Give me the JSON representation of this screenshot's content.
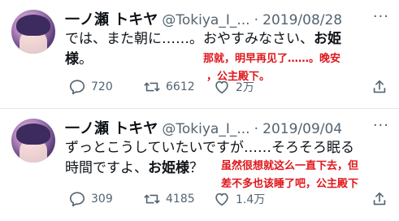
{
  "tweets": [
    {
      "name": "一ノ瀬 トキヤ",
      "handle": "@Tokiya_I_...",
      "separator": "·",
      "date": "2019/08/28",
      "more": "···",
      "text_line1_plain": "では、また朝に……。おやすみなさい、",
      "text_line1_bold": "お姫",
      "text_line2_bold": "様",
      "text_line2_plain": "。",
      "annotation_lines": [
        "那就，明早再见了……。晚安",
        "，公主殿下。"
      ],
      "replies": "720",
      "retweets": "6612",
      "likes": "2万"
    },
    {
      "name": "一ノ瀬 トキヤ",
      "handle": "@Tokiya_I_...",
      "separator": "·",
      "date": "2019/09/04",
      "more": "···",
      "text_line1": "ずっとこうしていたいですが……そろそろ眠る",
      "text_line2_plain": "時間ですよ、",
      "text_line2_bold": "お姫様",
      "text_line2_end": "？",
      "annotation_lines": [
        "虽然很想就这么一直下去，但",
        "差不多也该睡了吧，公主殿下"
      ],
      "replies": "309",
      "retweets": "4185",
      "likes": "1.4万"
    }
  ],
  "colors": {
    "annotation": "#e0161b",
    "secondary": "#536471",
    "text": "#0f1419"
  },
  "icons": [
    "reply-icon",
    "retweet-icon",
    "like-icon",
    "share-icon",
    "more-icon"
  ]
}
